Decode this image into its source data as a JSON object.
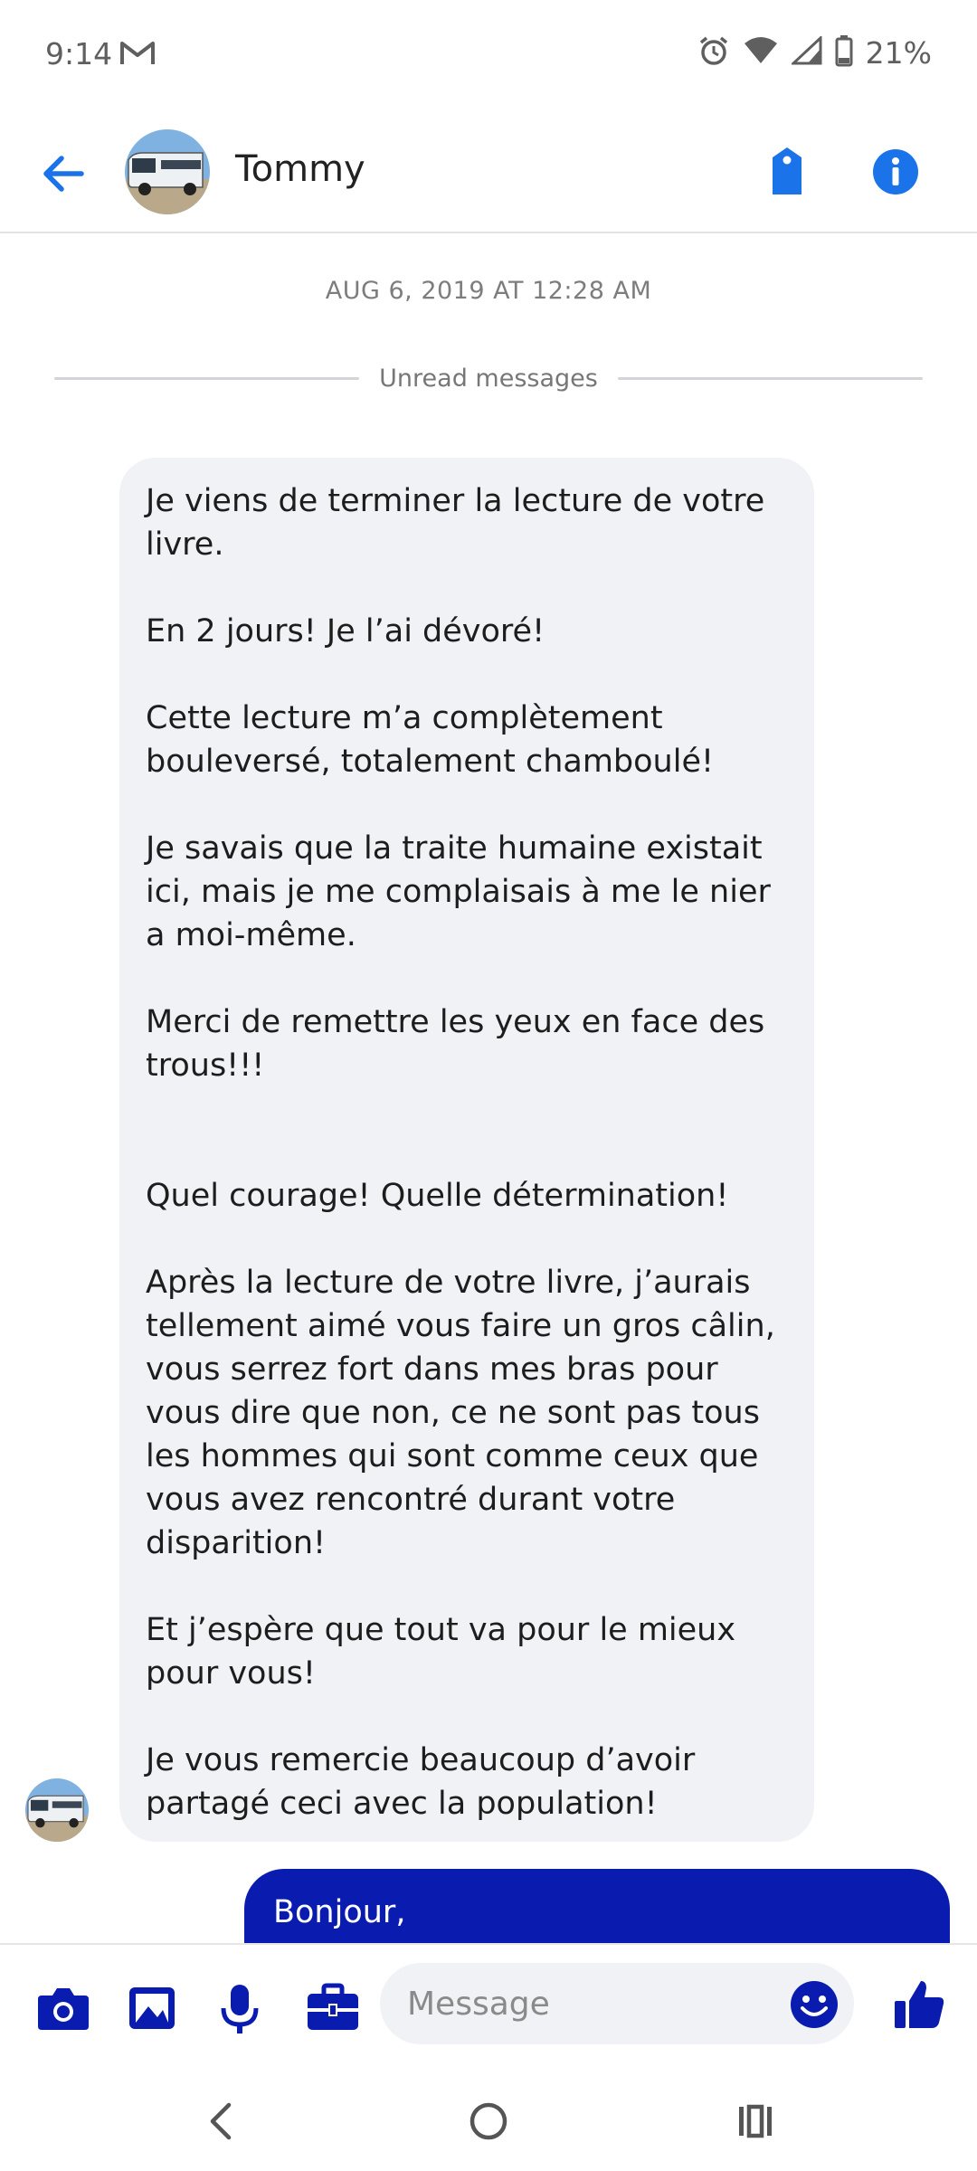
{
  "status_bar": {
    "time": "9:14",
    "battery_percent": "21%",
    "icons": [
      "mail-icon",
      "alarm-icon",
      "wifi-icon",
      "signal-icon",
      "battery-icon"
    ]
  },
  "header": {
    "back_icon": "back-arrow-icon",
    "contact_name": "Tommy",
    "avatar": "contact-avatar-bus",
    "tag_icon": "tag-icon",
    "info_icon": "info-icon"
  },
  "conversation": {
    "timestamp": "AUG 6, 2019 AT 12:28 AM",
    "unread_label": "Unread messages",
    "incoming_message": "Je viens de terminer la lecture de votre livre.\n\nEn 2 jours! Je l’ai dévoré!\n\nCette lecture m’a complètement bouleversé, totalement chamboulé!\n\nJe savais que la traite humaine existait ici, mais je me complaisais à me le nier a moi-même.\n\nMerci de remettre les yeux en face des trous!!!\n\n\nQuel courage! Quelle détermination!\n\nAprès la lecture de votre livre, j’aurais tellement aimé vous faire un gros câlin, vous serrez fort dans mes bras pour vous dire que non, ce ne sont pas tous les hommes qui sont comme ceux que vous avez rencontré durant votre disparition!\n\nEt j’espère que tout va pour le mieux pour vous!\n\nJe vous remercie beaucoup d’avoir partagé ceci avec la population!",
    "outgoing_message": "Bonjour,"
  },
  "composer": {
    "placeholder": "Message",
    "icons": [
      "camera-icon",
      "gallery-icon",
      "microphone-icon",
      "briefcase-icon",
      "emoji-icon",
      "thumbs-up-icon"
    ]
  },
  "navbar": {
    "icons": [
      "nav-back-icon",
      "nav-home-icon",
      "nav-recents-icon"
    ]
  },
  "colors": {
    "accent": "#1a73e8",
    "brand_dark": "#0a1bb0",
    "bubble_incoming": "#f1f2f6"
  }
}
